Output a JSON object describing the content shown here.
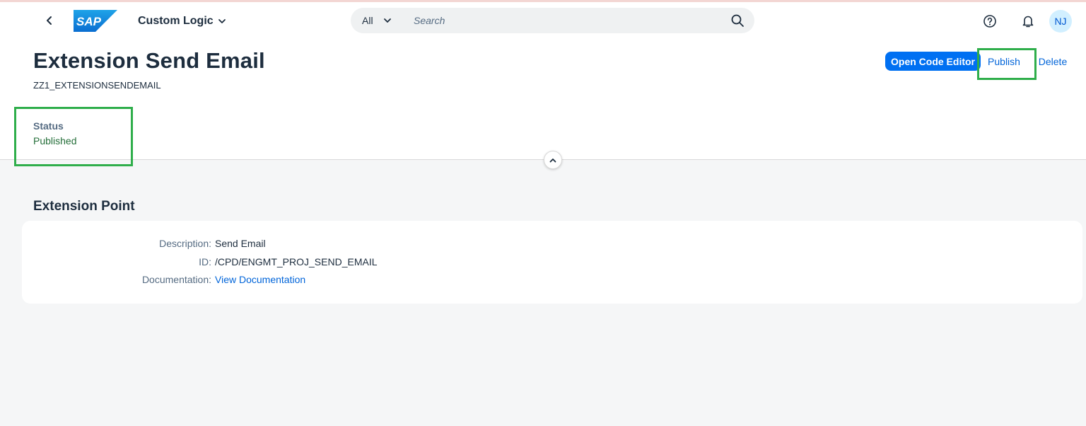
{
  "shellbar": {
    "app_title": "Custom Logic",
    "search_scope": "All",
    "search_placeholder": "Search",
    "avatar_initials": "NJ",
    "logo_text": "SAP",
    "colors": {
      "logo_blue": "#0a6ed1",
      "avatar_bg": "#d1efff"
    }
  },
  "header": {
    "title": "Extension Send Email",
    "subtitle": "ZZ1_EXTENSIONSENDEMAIL",
    "actions": {
      "open_code_editor": "Open Code Editor",
      "publish": "Publish",
      "delete": "Delete"
    },
    "status": {
      "label": "Status",
      "value": "Published",
      "color": "#256f3a"
    },
    "highlight_color": "#2fae4b"
  },
  "extension_point": {
    "title": "Extension Point",
    "fields": [
      {
        "label": "Description:",
        "value": "Send Email"
      },
      {
        "label": "ID:",
        "value": "/CPD/ENGMT_PROJ_SEND_EMAIL"
      },
      {
        "label": "Documentation:",
        "value": "View Documentation"
      }
    ]
  },
  "icons": {
    "back": "chevron-left-icon",
    "app_menu": "chevron-down-icon",
    "scope": "chevron-down-icon",
    "search": "search-icon",
    "help": "help-icon",
    "notifications": "bell-icon",
    "collapse": "chevron-up-icon"
  }
}
